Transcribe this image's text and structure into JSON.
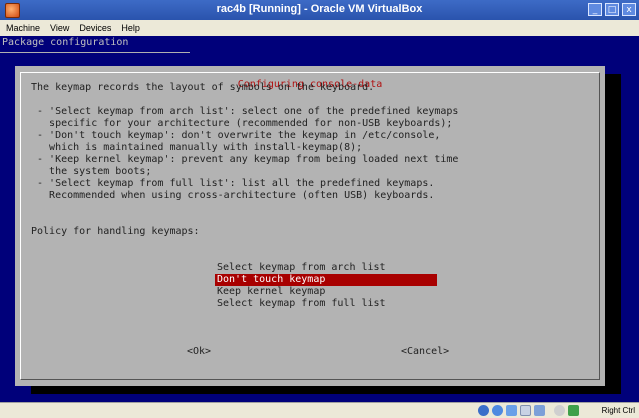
{
  "window": {
    "title": "rac4b [Running] - Oracle VM VirtualBox"
  },
  "menu": [
    "Machine",
    "View",
    "Devices",
    "Help"
  ],
  "screen": {
    "package_title": "Package configuration",
    "dialog_title": "Configuring console-data",
    "lines": [
      "The keymap records the layout of symbols on the keyboard.",
      "",
      " - 'Select keymap from arch list': select one of the predefined keymaps",
      "   specific for your architecture (recommended for non-USB keyboards);",
      " - 'Don't touch keymap': don't overwrite the keymap in /etc/console,",
      "   which is maintained manually with install-keymap(8);",
      " - 'Keep kernel keymap': prevent any keymap from being loaded next time",
      "   the system boots;",
      " - 'Select keymap from full list': list all the predefined keymaps.",
      "   Recommended when using cross-architecture (often USB) keyboards.",
      "",
      "Policy for handling keymaps:"
    ],
    "choices": [
      {
        "label": "Select keymap from arch list",
        "selected": false
      },
      {
        "label": "Don't touch keymap",
        "selected": true
      },
      {
        "label": "Keep kernel keymap",
        "selected": false
      },
      {
        "label": "Select keymap from full list",
        "selected": false
      }
    ],
    "ok_label": "<Ok>",
    "cancel_label": "<Cancel>"
  },
  "statusbar": {
    "host_key": "Right Ctrl",
    "icons": [
      "hard-disk-icon",
      "cd-icon",
      "network-icon",
      "usb-icon",
      "shared-folder-icon",
      "mouse-integration-icon",
      "capture-icon"
    ]
  },
  "colors": {
    "title_bar": "#2a53ad",
    "vm_background": "#00007a",
    "dialog": "#b3b3b3",
    "selection": "#a80000",
    "dialog_title": "#b01010"
  }
}
